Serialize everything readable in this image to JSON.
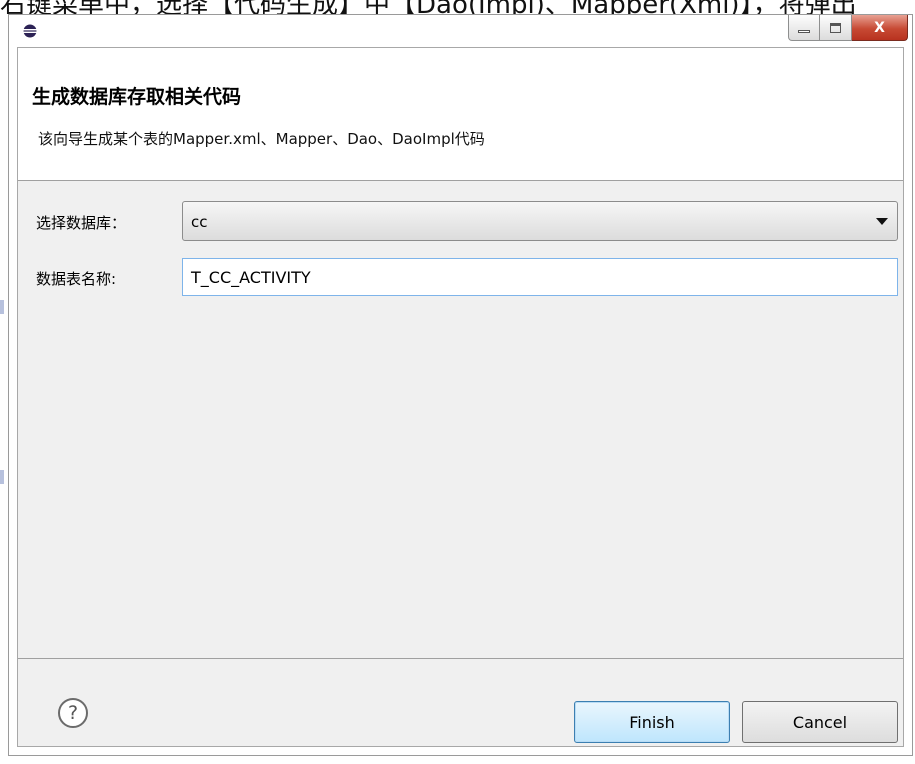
{
  "caption_strip": {
    "text": "右键菜单中，选择【代码生成】中【Dao(Impl)、Mapper(Xml)】，将弹出"
  },
  "window": {
    "controls": {
      "minimize": "—",
      "maximize": "□",
      "close": "X"
    }
  },
  "header": {
    "title": "生成数据库存取相关代码",
    "description": "该向导生成某个表的Mapper.xml、Mapper、Dao、DaoImpl代码"
  },
  "form": {
    "database_label": "选择数据库：",
    "database_value": "cc",
    "table_label": "数据表名称:",
    "table_value": "T_CC_ACTIVITY"
  },
  "footer": {
    "help_icon": "?",
    "finish_label": "Finish",
    "cancel_label": "Cancel"
  },
  "colors": {
    "close_button": "#c74a34",
    "finish_border": "#3c7fb1",
    "input_border": "#7eb4ea",
    "client_bg": "#f0f0f0"
  },
  "icons": {
    "app": "eclipse-icon",
    "help": "help-icon",
    "dropdown": "chevron-down-icon"
  }
}
